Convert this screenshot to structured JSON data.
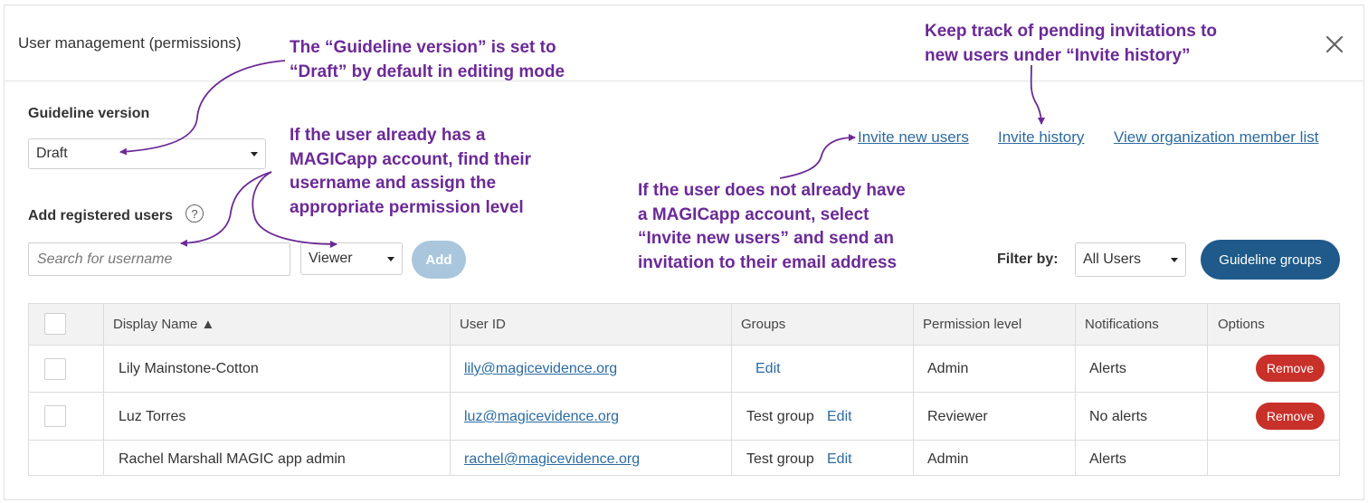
{
  "dialog": {
    "title": "User management (permissions)",
    "close_icon": "close-icon"
  },
  "guideline": {
    "label": "Guideline version",
    "selected": "Draft"
  },
  "add_users": {
    "label": "Add registered users",
    "help_glyph": "?",
    "search_placeholder": "Search for username",
    "permission_selected": "Viewer",
    "add_label": "Add"
  },
  "links": {
    "invite_new": "Invite new users",
    "invite_history": "Invite history",
    "member_list": "View organization member list"
  },
  "filter": {
    "label": "Filter by:",
    "selected": "All Users",
    "groups_button": "Guideline groups"
  },
  "table": {
    "headers": {
      "display_name": "Display Name ▲",
      "user_id": "User ID",
      "groups": "Groups",
      "permission": "Permission level",
      "notifications": "Notifications",
      "options": "Options"
    },
    "rows": [
      {
        "name": "Lily Mainstone-Cotton",
        "email": "lily@magicevidence.org",
        "group": "",
        "edit": "Edit",
        "permission": "Admin",
        "notifications": "Alerts",
        "remove": "Remove"
      },
      {
        "name": "Luz Torres",
        "email": "luz@magicevidence.org",
        "group": "Test group",
        "edit": "Edit",
        "permission": "Reviewer",
        "notifications": "No alerts",
        "remove": "Remove"
      },
      {
        "name": "Rachel Marshall MAGIC app admin",
        "email": "rachel@magicevidence.org",
        "group": "Test group",
        "edit": "Edit",
        "permission": "Admin",
        "notifications": "Alerts"
      }
    ]
  },
  "annotations": {
    "guideline_line1": "The “Guideline version” is set to",
    "guideline_line2": "“Draft” by default in editing mode",
    "history_line1": "Keep track of pending invitations to",
    "history_line2": "new users under “Invite history”",
    "existing_line1": "If the user already has a",
    "existing_line2": "MAGICapp account, find their",
    "existing_line3": "username and assign the",
    "existing_line4": "appropriate permission level",
    "new_line1": "If the user does not already have",
    "new_line2": "a MAGICapp account, select",
    "new_line3": "“Invite new users” and send an",
    "new_line4": "invitation to their email address"
  },
  "colors": {
    "annotation": "#6b2a96",
    "link": "#2c6aa0",
    "primary_button": "#1f5a8a",
    "disabled_button": "#a9c6dc",
    "danger_button": "#c8302a"
  }
}
